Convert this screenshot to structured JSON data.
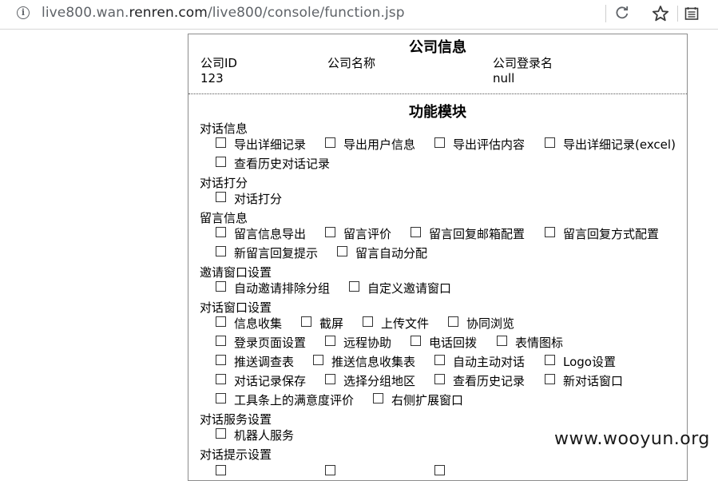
{
  "browser": {
    "url_prefix": "live800.wan.",
    "url_host": "renren.com",
    "url_path": "/live800/console/function.jsp"
  },
  "company": {
    "title": "公司信息",
    "headers": [
      "公司ID",
      "公司名称",
      "公司登录名"
    ],
    "values": [
      "123",
      "",
      "null"
    ]
  },
  "modules": {
    "title": "功能模块",
    "groups": [
      {
        "label": "对话信息",
        "options": [
          "导出详细记录",
          "导出用户信息",
          "导出评估内容",
          "导出详细记录(excel)",
          "查看历史对话记录"
        ]
      },
      {
        "label": "对话打分",
        "options": [
          "对话打分"
        ]
      },
      {
        "label": "留言信息",
        "options": [
          "留言信息导出",
          "留言评价",
          "留言回复邮箱配置",
          "留言回复方式配置",
          "新留言回复提示",
          "留言自动分配"
        ]
      },
      {
        "label": "邀请窗口设置",
        "options": [
          "自动邀请排除分组",
          "自定义邀请窗口"
        ]
      },
      {
        "label": "对话窗口设置",
        "options": [
          "信息收集",
          "截屏",
          "上传文件",
          "协同浏览",
          "登录页面设置",
          "远程协助",
          "电话回拨",
          "表情图标",
          "推送调查表",
          "推送信息收集表",
          "自动主动对话",
          "Logo设置",
          "对话记录保存",
          "选择分组地区",
          "查看历史记录",
          "新对话窗口",
          "工具条上的满意度评价",
          "右侧扩展窗口"
        ]
      },
      {
        "label": "对话服务设置",
        "options": [
          "机器人服务"
        ]
      },
      {
        "label": "对话提示设置",
        "options": []
      }
    ]
  },
  "watermark": "www.wooyun.org"
}
